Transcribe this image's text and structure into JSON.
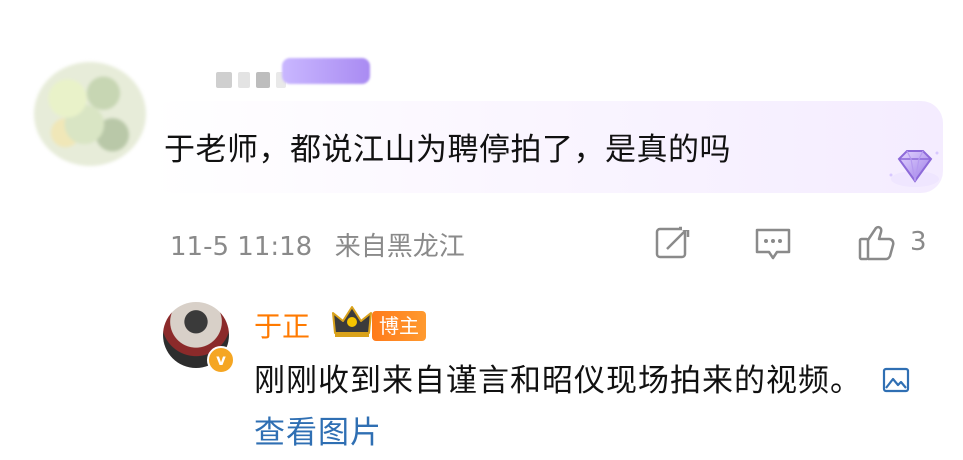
{
  "comment": {
    "text": "于老师，都说江山为聘停拍了，是真的吗",
    "date": "11-5 11:18",
    "location": "来自黑龙江",
    "likes": "3"
  },
  "reply": {
    "author": "于正",
    "author_tag": "博主",
    "verified_mark": "v",
    "text": "刚刚收到来自谨言和昭仪现场拍来的视频。",
    "view_image_label": "查看图片"
  },
  "icons": {
    "share": "share-icon",
    "reply": "comment-icon",
    "like": "thumbs-up-icon",
    "badge": "diamond-icon",
    "crown": "crown-icon",
    "image": "image-icon"
  },
  "colors": {
    "author_orange": "#ff7a00",
    "link_blue": "#2f6fb3",
    "meta_gray": "#8a8a8a"
  }
}
